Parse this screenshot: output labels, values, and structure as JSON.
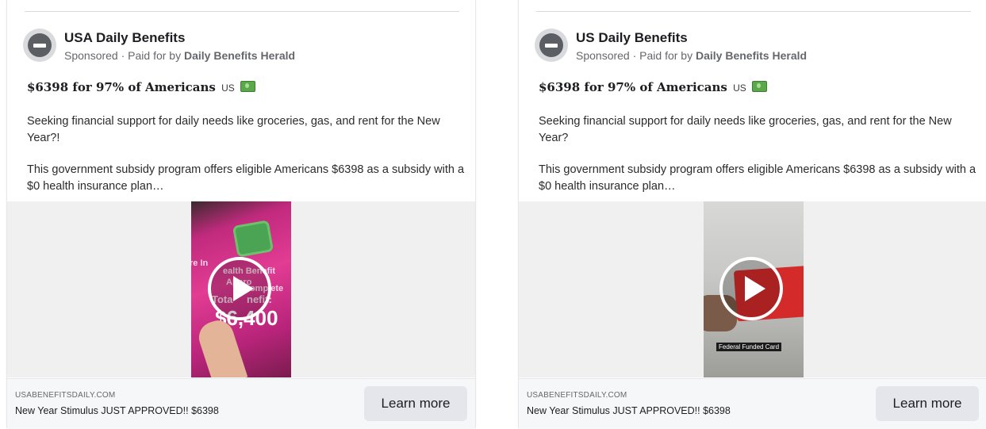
{
  "ads": [
    {
      "page_name": "USA Daily Benefits",
      "sponsored": "Sponsored",
      "separator": "·",
      "paid_for_prefix": "Paid for by",
      "payer": "Daily Benefits Herald",
      "headline": "$6398 for 97% of Americans",
      "country": "US",
      "paragraph_1": "Seeking financial support for daily needs like groceries, gas, and rent for the New Year?!",
      "paragraph_2": "This government subsidy program offers eligible Americans $6398 as a subsidy with a $0 health insurance plan…",
      "video": {
        "overlay_lines": [
          "re In",
          "ealth Benefit",
          "Appro",
          "Complete",
          "Tota",
          "nefit:"
        ],
        "amount": "$6,400"
      },
      "footer": {
        "domain": "USABENEFITSDAILY.COM",
        "cta_text": "New Year Stimulus JUST APPROVED!! $6398",
        "button_label": "Learn more"
      }
    },
    {
      "page_name": "US Daily Benefits",
      "sponsored": "Sponsored",
      "separator": "·",
      "paid_for_prefix": "Paid for by",
      "payer": "Daily Benefits Herald",
      "headline": "$6398 for 97% of Americans",
      "country": "US",
      "paragraph_1": "Seeking financial support for daily needs like groceries, gas, and rent for the New Year?",
      "paragraph_2": "This government subsidy program offers eligible Americans $6398 as a subsidy with a $0 health insurance plan…",
      "video": {
        "caption": "Federal Funded Card"
      },
      "footer": {
        "domain": "USABENEFITSDAILY.COM",
        "cta_text": "New Year Stimulus JUST APPROVED!! $6398",
        "button_label": "Learn more"
      }
    }
  ],
  "colors": {
    "secondary_text": "#65676b",
    "footer_bg": "#f6f7f8",
    "button_bg": "#e4e6eb",
    "media_bg": "#f0f0f1",
    "video1_accent": "#e23c93",
    "video2_card": "#d42a2a"
  },
  "icons": [
    "avatar-blocked-icon",
    "money-emoji-icon",
    "play-icon"
  ]
}
